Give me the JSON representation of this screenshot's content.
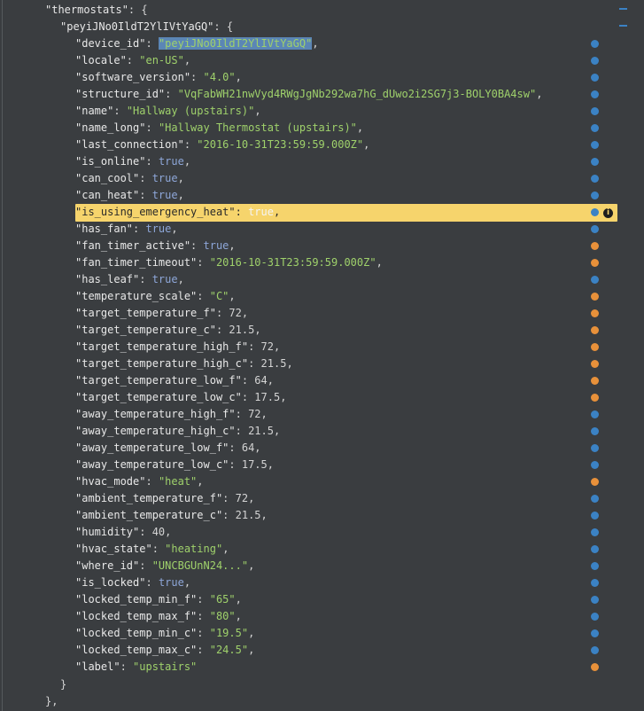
{
  "root_key": "\"thermostats\"",
  "device_key": "\"peyiJNo0IldT2YlIVtYaGQ\"",
  "lines": [
    {
      "key": "\"device_id\"",
      "val": "\"peyiJNo0IldT2YlIVtYaGQ\"",
      "type": "sel",
      "trail": ",",
      "dot": "blue"
    },
    {
      "key": "\"locale\"",
      "val": "\"en-US\"",
      "type": "str",
      "trail": ",",
      "dot": "blue"
    },
    {
      "key": "\"software_version\"",
      "val": "\"4.0\"",
      "type": "str",
      "trail": ",",
      "dot": "blue"
    },
    {
      "key": "\"structure_id\"",
      "val": "\"VqFabWH21nwVyd4RWgJgNb292wa7hG_dUwo2i2SG7j3-BOLY0BA4sw\"",
      "type": "str",
      "trail": ",",
      "dot": "blue"
    },
    {
      "key": "\"name\"",
      "val": "\"Hallway (upstairs)\"",
      "type": "str",
      "trail": ",",
      "dot": "blue"
    },
    {
      "key": "\"name_long\"",
      "val": "\"Hallway Thermostat (upstairs)\"",
      "type": "str",
      "trail": ",",
      "dot": "blue"
    },
    {
      "key": "\"last_connection\"",
      "val": "\"2016-10-31T23:59:59.000Z\"",
      "type": "str",
      "trail": ",",
      "dot": "blue"
    },
    {
      "key": "\"is_online\"",
      "val": "true",
      "type": "kw",
      "trail": ",",
      "dot": "blue"
    },
    {
      "key": "\"can_cool\"",
      "val": "true",
      "type": "kw",
      "trail": ",",
      "dot": "blue"
    },
    {
      "key": "\"can_heat\"",
      "val": "true",
      "type": "kw",
      "trail": ",",
      "dot": "blue"
    },
    {
      "key": "\"is_using_emergency_heat\"",
      "val": "true",
      "type": "kw",
      "trail": ",",
      "dot": "blue",
      "highlight": true
    },
    {
      "key": "\"has_fan\"",
      "val": "true",
      "type": "kw",
      "trail": ",",
      "dot": "blue"
    },
    {
      "key": "\"fan_timer_active\"",
      "val": "true",
      "type": "kw",
      "trail": ",",
      "dot": "orange"
    },
    {
      "key": "\"fan_timer_timeout\"",
      "val": "\"2016-10-31T23:59:59.000Z\"",
      "type": "str",
      "trail": ",",
      "dot": "orange"
    },
    {
      "key": "\"has_leaf\"",
      "val": "true",
      "type": "kw",
      "trail": ",",
      "dot": "blue"
    },
    {
      "key": "\"temperature_scale\"",
      "val": "\"C\"",
      "type": "str",
      "trail": ",",
      "dot": "orange"
    },
    {
      "key": "\"target_temperature_f\"",
      "val": "72",
      "type": "num",
      "trail": ",",
      "dot": "orange"
    },
    {
      "key": "\"target_temperature_c\"",
      "val": "21.5",
      "type": "num",
      "trail": ",",
      "dot": "orange"
    },
    {
      "key": "\"target_temperature_high_f\"",
      "val": "72",
      "type": "num",
      "trail": ",",
      "dot": "orange"
    },
    {
      "key": "\"target_temperature_high_c\"",
      "val": "21.5",
      "type": "num",
      "trail": ",",
      "dot": "orange"
    },
    {
      "key": "\"target_temperature_low_f\"",
      "val": "64",
      "type": "num",
      "trail": ",",
      "dot": "orange"
    },
    {
      "key": "\"target_temperature_low_c\"",
      "val": "17.5",
      "type": "num",
      "trail": ",",
      "dot": "orange"
    },
    {
      "key": "\"away_temperature_high_f\"",
      "val": "72",
      "type": "num",
      "trail": ",",
      "dot": "blue"
    },
    {
      "key": "\"away_temperature_high_c\"",
      "val": "21.5",
      "type": "num",
      "trail": ",",
      "dot": "blue"
    },
    {
      "key": "\"away_temperature_low_f\"",
      "val": "64",
      "type": "num",
      "trail": ",",
      "dot": "blue"
    },
    {
      "key": "\"away_temperature_low_c\"",
      "val": "17.5",
      "type": "num",
      "trail": ",",
      "dot": "blue"
    },
    {
      "key": "\"hvac_mode\"",
      "val": "\"heat\"",
      "type": "str",
      "trail": ",",
      "dot": "orange"
    },
    {
      "key": "\"ambient_temperature_f\"",
      "val": "72",
      "type": "num",
      "trail": ",",
      "dot": "blue"
    },
    {
      "key": "\"ambient_temperature_c\"",
      "val": "21.5",
      "type": "num",
      "trail": ",",
      "dot": "blue"
    },
    {
      "key": "\"humidity\"",
      "val": "40",
      "type": "num",
      "trail": ",",
      "dot": "blue"
    },
    {
      "key": "\"hvac_state\"",
      "val": "\"heating\"",
      "type": "str",
      "trail": ",",
      "dot": "blue"
    },
    {
      "key": "\"where_id\"",
      "val": "\"UNCBGUnN24...\"",
      "type": "str",
      "trail": ",",
      "dot": "blue"
    },
    {
      "key": "\"is_locked\"",
      "val": "true",
      "type": "kw",
      "trail": ",",
      "dot": "blue"
    },
    {
      "key": "\"locked_temp_min_f\"",
      "val": "\"65\"",
      "type": "str",
      "trail": ",",
      "dot": "blue"
    },
    {
      "key": "\"locked_temp_max_f\"",
      "val": "\"80\"",
      "type": "str",
      "trail": ",",
      "dot": "blue"
    },
    {
      "key": "\"locked_temp_min_c\"",
      "val": "\"19.5\"",
      "type": "str",
      "trail": ",",
      "dot": "blue"
    },
    {
      "key": "\"locked_temp_max_c\"",
      "val": "\"24.5\"",
      "type": "str",
      "trail": ",",
      "dot": "blue"
    },
    {
      "key": "\"label\"",
      "val": "\"upstairs\"",
      "type": "str",
      "trail": "",
      "dot": "orange"
    }
  ],
  "close_inner": "}",
  "close_outer": "},",
  "colors": {
    "accent_blue": "#3b82c4",
    "accent_orange": "#e8913a",
    "highlight": "#f6d46c"
  },
  "icons": {
    "info": "info-icon"
  }
}
